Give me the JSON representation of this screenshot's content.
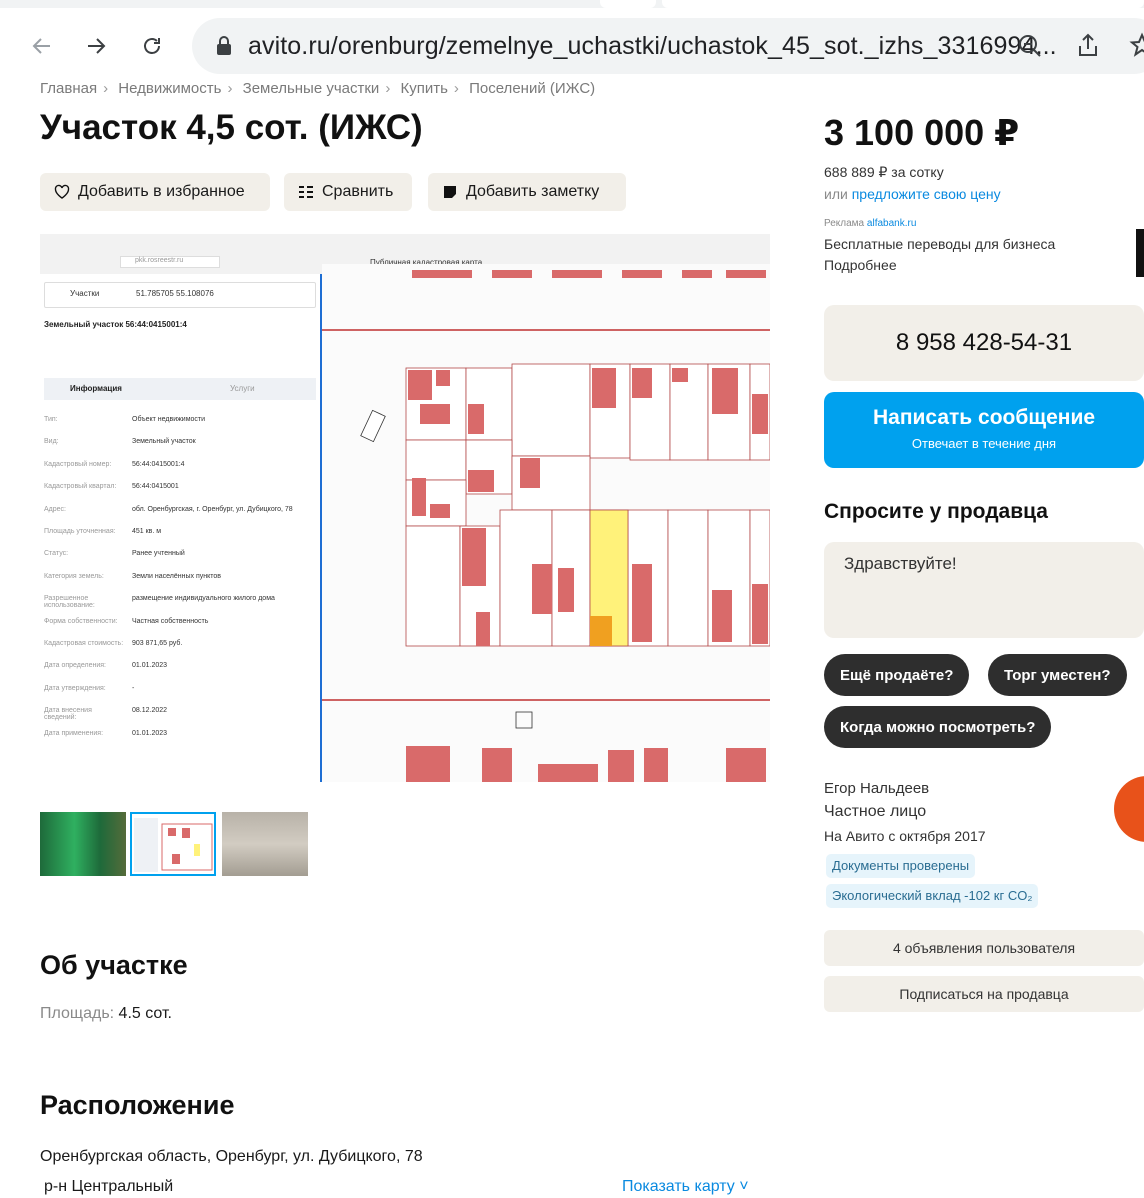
{
  "browser": {
    "url": "avito.ru/orenburg/zemelnye_uchastki/uchastok_45_sot._izhs_3316994..."
  },
  "breadcrumb": [
    "Главная",
    "Недвижимость",
    "Земельные участки",
    "Купить",
    "Поселений (ИЖС)"
  ],
  "title": "Участок 4,5 сот. (ИЖС)",
  "actions": {
    "favorite": "Добавить в избранное",
    "compare": "Сравнить",
    "note": "Добавить заметку"
  },
  "image": {
    "map_header": "Публичная кадастровая карта",
    "address_bar": "pkk.rosreestr.ru",
    "search_type": "Участки",
    "search_value": "51.785705 55.108076",
    "parcel_title": "Земельный участок 56:44:0415001:4",
    "tab_info": "Информация",
    "tab_services": "Услуги",
    "rows": [
      {
        "k": "Тип:",
        "v": "Объект недвижимости"
      },
      {
        "k": "Вид:",
        "v": "Земельный участок"
      },
      {
        "k": "Кадастровый номер:",
        "v": "56:44:0415001:4"
      },
      {
        "k": "Кадастровый квартал:",
        "v": "56:44:0415001"
      },
      {
        "k": "Адрес:",
        "v": "обл. Оренбургская, г. Оренбург, ул. Дубицкого, 78"
      },
      {
        "k": "Площадь уточненная:",
        "v": "451 кв. м"
      },
      {
        "k": "Статус:",
        "v": "Ранее учтенный"
      },
      {
        "k": "Категория земель:",
        "v": "Земли населённых пунктов"
      },
      {
        "k": "Разрешенное использование:",
        "v": "размещение индивидуального жилого дома"
      },
      {
        "k": "Форма собственности:",
        "v": "Частная собственность"
      },
      {
        "k": "Кадастровая стоимость:",
        "v": "903 871,65 руб."
      },
      {
        "k": "Дата определения:",
        "v": "01.01.2023"
      },
      {
        "k": "Дата утверждения:",
        "v": "-"
      },
      {
        "k": "Дата внесения сведений:",
        "v": "08.12.2022"
      },
      {
        "k": "Дата применения:",
        "v": "01.01.2023"
      }
    ]
  },
  "about": {
    "heading": "Об участке",
    "area_label": "Площадь:",
    "area_value": "4.5 сот."
  },
  "location": {
    "heading": "Расположение",
    "address": "Оренбургская область, Оренбург, ул. Дубицкого, 78",
    "district": "р-н Центральный",
    "show_map": "Показать карту"
  },
  "sidebar": {
    "price": "3 100 000 ₽",
    "price_per": "688 889 ₽ за сотку",
    "offer_prefix": "или",
    "offer_link": "предложите свою цену",
    "ad_label": "Реклама",
    "ad_domain": "alfabank.ru",
    "ad_text": "Бесплатные переводы для бизнеса",
    "ad_more": "Подробнее",
    "phone": "8 958 428-54-31",
    "message_btn": "Написать сообщение",
    "message_sub": "Отвечает в течение дня",
    "ask_title": "Спросите у продавца",
    "ask_placeholder": "Здравствуйте!",
    "chips": [
      "Ещё продаёте?",
      "Торг уместен?",
      "Когда можно посмотреть?"
    ],
    "seller_name": "Егор Нальдеев",
    "seller_type": "Частное лицо",
    "seller_since": "На Авито с октября 2017",
    "badge_docs": "Документы проверены",
    "badge_eco": "Экологический вклад -102 кг CO₂",
    "btn_ads": "4 объявления пользователя",
    "btn_subscribe": "Подписаться на продавца"
  }
}
